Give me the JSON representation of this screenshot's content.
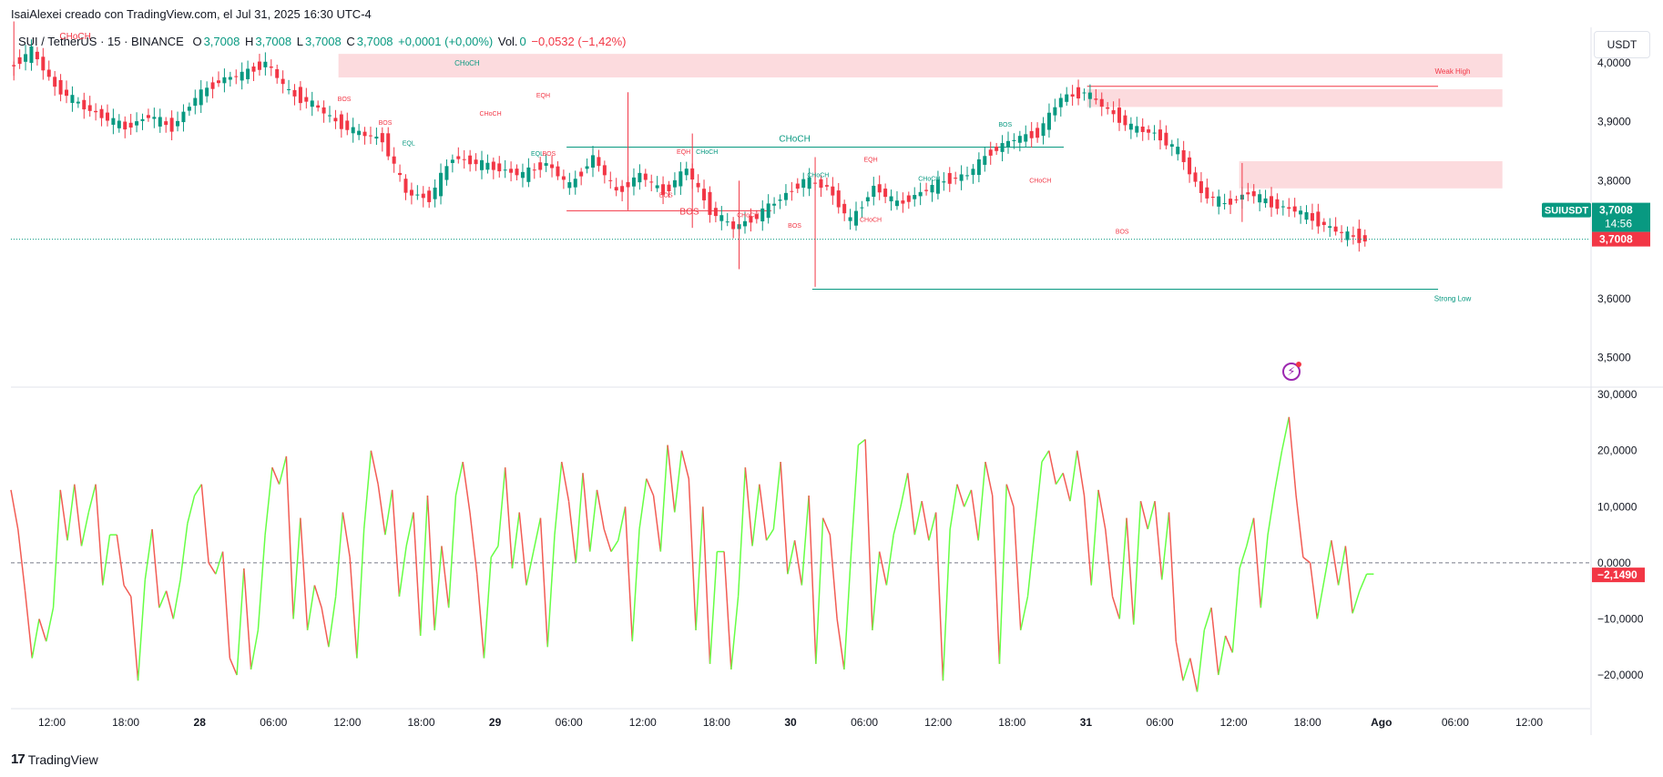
{
  "header": {
    "attribution": "IsaiAlexei creado con TradingView.com, el Jul 31, 2025 16:30 UTC-4",
    "symbol": "SUI / TetherUS · 15 · BINANCE",
    "o_label": "O",
    "o_value": "3,7008",
    "h_label": "H",
    "h_value": "3,7008",
    "l_label": "L",
    "l_value": "3,7008",
    "c_label": "C",
    "c_value": "3,7008",
    "change": "+0,0001 (+0,00%)",
    "vol_label": "Vol.",
    "vol_value": "0",
    "osc_change": "−0,0532 (−1,42%)"
  },
  "currency_button": "USDT",
  "footer": {
    "logo_text": "TradingView",
    "logo_mark": "17"
  },
  "colors": {
    "up": "#089981",
    "down": "#f23645",
    "osc_up": "#66ff44",
    "osc_down": "#f25c54",
    "zone": "#fbd5d8",
    "grid": "#e0e3eb"
  },
  "chart_data": [
    {
      "type": "candlestick",
      "symbol": "SUIUSDT",
      "interval": "15",
      "ylim": [
        3.45,
        4.06
      ],
      "y_ticks": [
        "4,0000",
        "3,9000",
        "3,8000",
        "3,7000",
        "3,6000",
        "3,5000"
      ],
      "y_tick_values": [
        4.0,
        3.9,
        3.8,
        3.7,
        3.6,
        3.5
      ],
      "last_price": "3,7008",
      "last_price_value": 3.7008,
      "countdown": "14:56",
      "price_label": "SUIUSDT",
      "path": [
        [
          0,
          3.99
        ],
        [
          4,
          4.02
        ],
        [
          8,
          3.96
        ],
        [
          12,
          3.93
        ],
        [
          16,
          3.91
        ],
        [
          20,
          3.89
        ],
        [
          24,
          3.91
        ],
        [
          28,
          3.89
        ],
        [
          32,
          3.94
        ],
        [
          36,
          3.97
        ],
        [
          40,
          3.98
        ],
        [
          44,
          4.0
        ],
        [
          48,
          3.95
        ],
        [
          52,
          3.93
        ],
        [
          56,
          3.9
        ],
        [
          60,
          3.88
        ],
        [
          64,
          3.87
        ],
        [
          68,
          3.78
        ],
        [
          72,
          3.77
        ],
        [
          76,
          3.84
        ],
        [
          80,
          3.83
        ],
        [
          84,
          3.82
        ],
        [
          88,
          3.81
        ],
        [
          92,
          3.83
        ],
        [
          96,
          3.79
        ],
        [
          100,
          3.84
        ],
        [
          104,
          3.78
        ],
        [
          108,
          3.81
        ],
        [
          112,
          3.78
        ],
        [
          116,
          3.82
        ],
        [
          120,
          3.75
        ],
        [
          124,
          3.72
        ],
        [
          128,
          3.74
        ],
        [
          132,
          3.77
        ],
        [
          136,
          3.8
        ],
        [
          140,
          3.79
        ],
        [
          144,
          3.73
        ],
        [
          148,
          3.79
        ],
        [
          152,
          3.76
        ],
        [
          156,
          3.78
        ],
        [
          160,
          3.8
        ],
        [
          164,
          3.81
        ],
        [
          168,
          3.85
        ],
        [
          172,
          3.87
        ],
        [
          176,
          3.88
        ],
        [
          180,
          3.94
        ],
        [
          184,
          3.95
        ],
        [
          188,
          3.92
        ],
        [
          192,
          3.89
        ],
        [
          196,
          3.88
        ],
        [
          200,
          3.85
        ],
        [
          204,
          3.78
        ],
        [
          208,
          3.76
        ],
        [
          212,
          3.78
        ],
        [
          216,
          3.76
        ],
        [
          220,
          3.75
        ],
        [
          224,
          3.73
        ],
        [
          228,
          3.71
        ],
        [
          232,
          3.7
        ]
      ],
      "wicks": [
        {
          "x": 0,
          "high": 4.07,
          "low": 3.97
        },
        {
          "x": 105,
          "high": 3.95,
          "low": 3.75
        },
        {
          "x": 116,
          "high": 3.88,
          "low": 3.72
        },
        {
          "x": 124,
          "high": 3.8,
          "low": 3.65
        },
        {
          "x": 137,
          "high": 3.84,
          "low": 3.62
        },
        {
          "x": 210,
          "high": 3.83,
          "low": 3.73
        }
      ],
      "levels": [
        {
          "name": "Weak High",
          "value": 3.96,
          "x_from": 184,
          "x_to": 244,
          "color": "#f23645",
          "label": "Weak High"
        },
        {
          "name": "Strong Low",
          "value": 3.616,
          "x_from": 137,
          "x_to": 244,
          "color": "#089981",
          "label": "Strong Low"
        },
        {
          "name": "CHoCH",
          "value": 3.857,
          "x_from": 95,
          "x_to": 180,
          "color": "#089981",
          "label": "CHoCH"
        },
        {
          "name": "BOS",
          "value": 3.749,
          "x_from": 95,
          "x_to": 130,
          "color": "#f23645",
          "label": "BOS"
        }
      ],
      "zones": [
        {
          "from": 3.975,
          "to": 4.015,
          "x_from": 56,
          "x_to": 255
        },
        {
          "from": 3.925,
          "to": 3.955,
          "x_from": 184,
          "x_to": 255
        },
        {
          "from": 3.787,
          "to": 3.833,
          "x_from": 210,
          "x_to": 255
        }
      ],
      "annotations": [
        {
          "text": "CHoCH",
          "x": 11,
          "y": 4.04,
          "color": "#f23645",
          "size": 10
        },
        {
          "text": "CHoCH",
          "x": 78,
          "y": 3.995,
          "color": "#089981",
          "size": 8
        },
        {
          "text": "BOS",
          "x": 57,
          "y": 3.935,
          "color": "#f23645",
          "size": 7
        },
        {
          "text": "BOS",
          "x": 64,
          "y": 3.895,
          "color": "#f23645",
          "size": 7
        },
        {
          "text": "EQL",
          "x": 68,
          "y": 3.86,
          "color": "#089981",
          "size": 7
        },
        {
          "text": "EQH",
          "x": 91,
          "y": 3.941,
          "color": "#f23645",
          "size": 7
        },
        {
          "text": "CHoCH",
          "x": 82,
          "y": 3.91,
          "color": "#f23645",
          "size": 7
        },
        {
          "text": "EQL",
          "x": 90,
          "y": 3.842,
          "color": "#089981",
          "size": 7
        },
        {
          "text": "BOS",
          "x": 92,
          "y": 3.842,
          "color": "#f23645",
          "size": 7
        },
        {
          "text": "EQH",
          "x": 115,
          "y": 3.845,
          "color": "#f23645",
          "size": 7
        },
        {
          "text": "CHoCH",
          "x": 119,
          "y": 3.845,
          "color": "#089981",
          "size": 7
        },
        {
          "text": "CHoCH",
          "x": 134,
          "y": 3.866,
          "color": "#089981",
          "size": 10
        },
        {
          "text": "BOS",
          "x": 112,
          "y": 3.772,
          "color": "#f23645",
          "size": 7
        },
        {
          "text": "BOS",
          "x": 116,
          "y": 3.743,
          "color": "#f23645",
          "size": 10
        },
        {
          "text": "CHoCH",
          "x": 126,
          "y": 3.738,
          "color": "#f23645",
          "size": 7
        },
        {
          "text": "BOS",
          "x": 134,
          "y": 3.72,
          "color": "#f23645",
          "size": 7
        },
        {
          "text": "CHoCH",
          "x": 138,
          "y": 3.806,
          "color": "#089981",
          "size": 7
        },
        {
          "text": "EQH",
          "x": 147,
          "y": 3.832,
          "color": "#f23645",
          "size": 7
        },
        {
          "text": "CHoCH",
          "x": 147,
          "y": 3.73,
          "color": "#f23645",
          "size": 7
        },
        {
          "text": "CHoCH",
          "x": 157,
          "y": 3.8,
          "color": "#089981",
          "size": 7
        },
        {
          "text": "BOS",
          "x": 170,
          "y": 3.892,
          "color": "#089981",
          "size": 7
        },
        {
          "text": "CHoCH",
          "x": 176,
          "y": 3.797,
          "color": "#f23645",
          "size": 7
        },
        {
          "text": "BOS",
          "x": 190,
          "y": 3.71,
          "color": "#f23645",
          "size": 7
        }
      ]
    },
    {
      "type": "line",
      "name": "",
      "ylim": [
        -26,
        31
      ],
      "y_ticks": [
        "30,0000",
        "20,0000",
        "10,0000",
        "0,0000",
        "−10,0000",
        "−20,0000"
      ],
      "y_tick_values": [
        30,
        20,
        10,
        0,
        -10,
        -20
      ],
      "last_value": "−2,1490",
      "last_value_num": -2.149,
      "values": [
        13,
        6,
        -5,
        -17,
        -10,
        -14,
        -8,
        13,
        4,
        14,
        3,
        9,
        14,
        -4,
        5,
        5,
        -4,
        -6,
        -21,
        -3,
        6,
        -8,
        -5,
        -10,
        -3,
        7,
        12,
        14,
        0,
        -2,
        2,
        -17,
        -20,
        -1,
        -19,
        -12,
        5,
        17,
        14,
        19,
        -10,
        8,
        -12,
        -4,
        -8,
        -15,
        -6,
        9,
        1,
        -17,
        6,
        20,
        14,
        5,
        13,
        -6,
        3,
        9,
        -13,
        12,
        -12,
        3,
        -8,
        12,
        18,
        9,
        -2,
        -17,
        1,
        3,
        17,
        -1,
        9,
        -4,
        2,
        8,
        -15,
        5,
        18,
        11,
        0,
        16,
        2,
        13,
        6,
        2,
        4,
        10,
        -14,
        6,
        15,
        12,
        2,
        21,
        9,
        20,
        15,
        -12,
        10,
        -18,
        2,
        2,
        -19,
        -6,
        17,
        3,
        14,
        4,
        6,
        18,
        -2,
        4,
        -4,
        12,
        -18,
        8,
        5,
        -10,
        -19,
        2,
        21,
        22,
        -12,
        2,
        -4,
        5,
        10,
        16,
        5,
        11,
        4,
        9,
        -21,
        6,
        14,
        10,
        13,
        4,
        18,
        12,
        -18,
        14,
        10,
        -12,
        -6,
        6,
        18,
        20,
        14,
        16,
        11,
        20,
        12,
        -4,
        13,
        6,
        -6,
        -10,
        8,
        -11,
        11,
        6,
        11,
        -3,
        9,
        -14,
        -21,
        -17,
        -23,
        -12,
        -8,
        -20,
        -13,
        -16,
        -1,
        3,
        8,
        -8,
        5,
        13,
        20,
        26,
        12,
        1,
        0,
        -10,
        -3,
        4,
        -4,
        3,
        -9,
        -5,
        -2,
        -2
      ]
    }
  ],
  "x_axis": {
    "ticks": [
      "12:00",
      "18:00",
      "28",
      "06:00",
      "12:00",
      "18:00",
      "29",
      "06:00",
      "12:00",
      "18:00",
      "30",
      "06:00",
      "12:00",
      "18:00",
      "31",
      "06:00",
      "12:00",
      "18:00",
      "Ago",
      "06:00",
      "12:00"
    ],
    "bold": [
      false,
      false,
      true,
      false,
      false,
      false,
      true,
      false,
      false,
      false,
      true,
      false,
      false,
      false,
      true,
      false,
      false,
      false,
      true,
      false,
      false
    ]
  }
}
